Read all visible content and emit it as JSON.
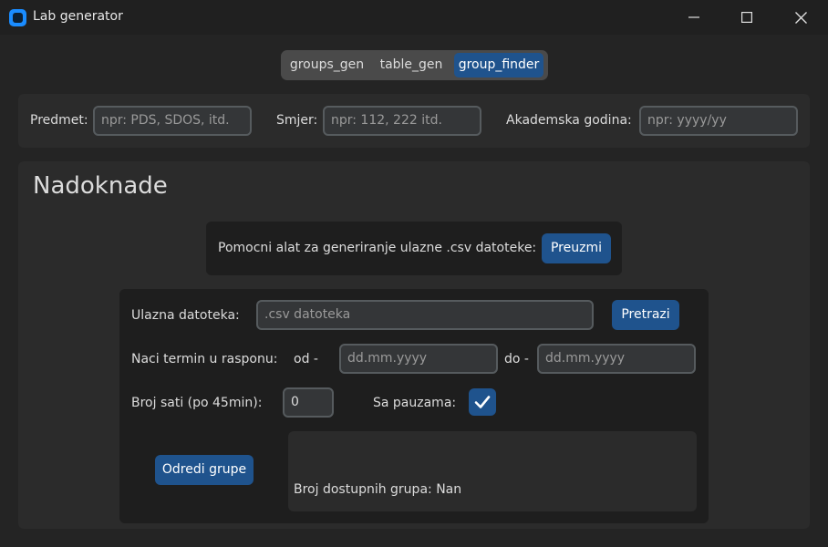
{
  "window": {
    "title": "Lab generator",
    "icon": "app-icon",
    "controls": [
      "minimize-icon",
      "maximize-icon",
      "close-icon"
    ]
  },
  "tabs": {
    "items": [
      {
        "label": "groups_gen",
        "active": false
      },
      {
        "label": "table_gen",
        "active": false
      },
      {
        "label": "group_finder",
        "active": true
      }
    ]
  },
  "top_form": {
    "predmet_label": "Predmet:",
    "predmet_placeholder": "npr: PDS, SDOS, itd.",
    "smjer_label": "Smjer:",
    "smjer_placeholder": "npr: 112, 222 itd.",
    "godina_label": "Akademska godina:",
    "godina_placeholder": "npr: yyyy/yy"
  },
  "section": {
    "heading": "Nadoknade",
    "helper_text": "Pomocni alat za generiranje ulazne .csv datoteke:",
    "download_button": "Preuzmi"
  },
  "inputs": {
    "file_label": "Ulazna datoteka:",
    "file_placeholder": ".csv datoteka",
    "browse_button": "Pretrazi",
    "range_label": "Naci termin u rasponu:",
    "from_label": "od -",
    "from_placeholder": "dd.mm.yyyy",
    "to_label": "do -",
    "to_placeholder": "dd.mm.yyyy",
    "hours_label": "Broj sati (po 45min):",
    "hours_value": "0",
    "breaks_label": "Sa pauzama:",
    "breaks_checked": true
  },
  "result": {
    "action_button": "Odredi grupe",
    "status_text": "Broj dostupnih grupa: Nan"
  },
  "colors": {
    "accent": "#1f538d",
    "background": "#242424",
    "frame": "#2b2b2b",
    "inner_frame": "#1e1e1e",
    "entry_bg": "#343638",
    "entry_border": "#565b5e"
  }
}
